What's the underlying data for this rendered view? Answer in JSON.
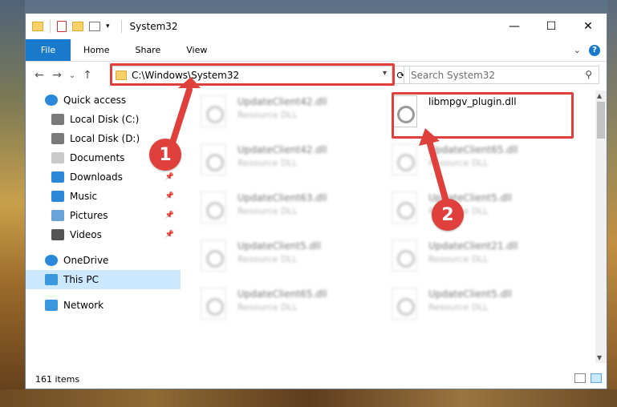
{
  "window": {
    "title": "System32",
    "controls": {
      "minimize": "—",
      "maximize": "☐",
      "close": "✕"
    }
  },
  "ribbon": {
    "tabs": [
      "File",
      "Home",
      "Share",
      "View"
    ],
    "chevron": "⌄",
    "help": "?"
  },
  "nav": {
    "back": "←",
    "forward": "→",
    "recent": "⌄",
    "up": "↑",
    "address": "C:\\Windows\\System32",
    "search_placeholder": "Search System32"
  },
  "sidebar": {
    "items": [
      {
        "label": "Quick access",
        "icon": "star-icon",
        "pinned": false
      },
      {
        "label": "Local Disk (C:)",
        "icon": "drive-icon",
        "pinned": false
      },
      {
        "label": "Local Disk (D:)",
        "icon": "drive-icon",
        "pinned": false
      },
      {
        "label": "Documents",
        "icon": "documents-icon",
        "pinned": true
      },
      {
        "label": "Downloads",
        "icon": "download-icon",
        "pinned": true
      },
      {
        "label": "Music",
        "icon": "music-icon",
        "pinned": true
      },
      {
        "label": "Pictures",
        "icon": "pictures-icon",
        "pinned": true
      },
      {
        "label": "Videos",
        "icon": "videos-icon",
        "pinned": true
      },
      {
        "label": "OneDrive",
        "icon": "cloud-icon",
        "pinned": false
      },
      {
        "label": "This PC",
        "icon": "computer-icon",
        "pinned": false,
        "selected": true
      },
      {
        "label": "Network",
        "icon": "network-icon",
        "pinned": false
      }
    ]
  },
  "files": [
    {
      "name": "UpdateClient42.dll",
      "type": "Resource DLL",
      "blurred": true
    },
    {
      "name": "libmpgv_plugin.dll",
      "type": "",
      "blurred": false
    },
    {
      "name": "UpdateClient42.dll",
      "type": "Resource DLL",
      "blurred": true
    },
    {
      "name": "UpdateClient65.dll",
      "type": "Resource DLL",
      "blurred": true
    },
    {
      "name": "UpdateClient63.dll",
      "type": "Resource DLL",
      "blurred": true
    },
    {
      "name": "UpdateClient5.dll",
      "type": "Resource DLL",
      "blurred": true
    },
    {
      "name": "UpdateClient5.dll",
      "type": "Resource DLL",
      "blurred": true
    },
    {
      "name": "UpdateClient21.dll",
      "type": "Resource DLL",
      "blurred": true
    },
    {
      "name": "UpdateClient65.dll",
      "type": "Resource DLL",
      "blurred": true
    },
    {
      "name": "UpdateClient5.dll",
      "type": "Resource DLL",
      "blurred": true
    }
  ],
  "status": {
    "item_count": "161 items"
  },
  "annotations": {
    "step1": "1",
    "step2": "2",
    "color": "#e0403c"
  }
}
